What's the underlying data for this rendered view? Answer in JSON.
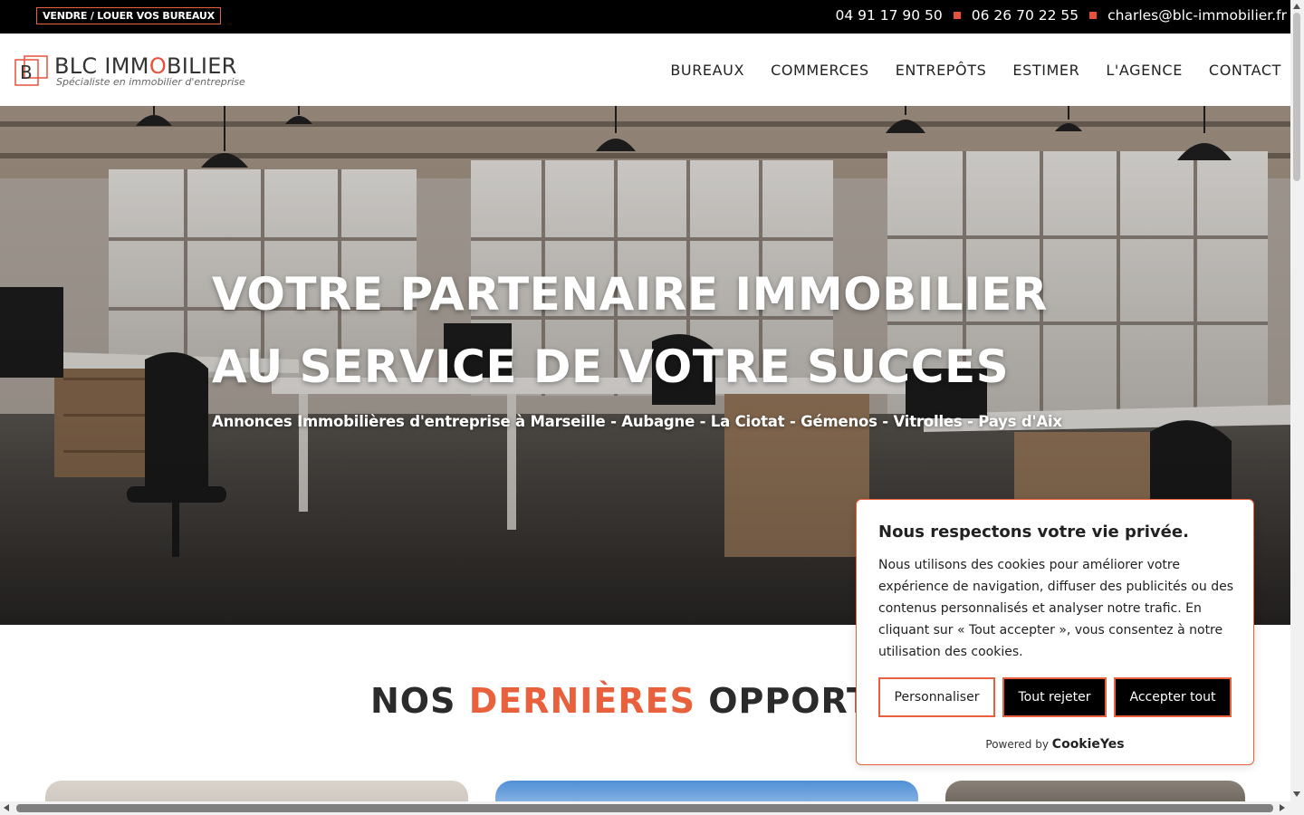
{
  "topbar": {
    "cta_label": "VENDRE / LOUER VOS BUREAUX",
    "phone_1": "04 91 17 90 50",
    "phone_2": "06 26 70 22 55",
    "email": "charles@blc-immobilier.fr"
  },
  "header": {
    "logo_text_pre": "BLC IMM",
    "logo_text_o": "O",
    "logo_text_post": "BILIER",
    "logo_tagline": "Spécialiste en immobilier d'entreprise",
    "nav": [
      "BUREAUX",
      "COMMERCES",
      "ENTREPÔTS",
      "ESTIMER",
      "L'AGENCE",
      "CONTACT"
    ]
  },
  "hero": {
    "title_line_1": "VOTRE PARTENAIRE IMMOBILIER",
    "title_line_2": "AU SERVICE DE VOTRE SUCCES",
    "subtitle": "Annonces Immobilières d'entreprise à Marseille - Aubagne - La Ciotat - Gémenos - Vitrolles - Pays d'Aix"
  },
  "section": {
    "title_pre": "NOS ",
    "title_accent": "DERNIÈRES",
    "title_post": " OPPORTUNI"
  },
  "cookie_banner": {
    "title": "Nous respectons votre vie privée.",
    "body": "Nous utilisons des cookies pour améliorer votre expérience de navigation, diffuser des publicités ou des contenus personnalisés et analyser notre trafic. En cliquant sur « Tout accepter », vous consentez à notre utilisation des cookies.",
    "btn_customize": "Personnaliser",
    "btn_reject": "Tout rejeter",
    "btn_accept": "Accepter tout",
    "powered_by": "Powered by",
    "brand": "CookieYes"
  },
  "colors": {
    "accent": "#e8603c",
    "topbar_bg": "#000000",
    "text_dark": "#2b2b2b"
  },
  "icons": {
    "logo": "blc-logo-icon",
    "separator": "square-bullet-icon"
  }
}
